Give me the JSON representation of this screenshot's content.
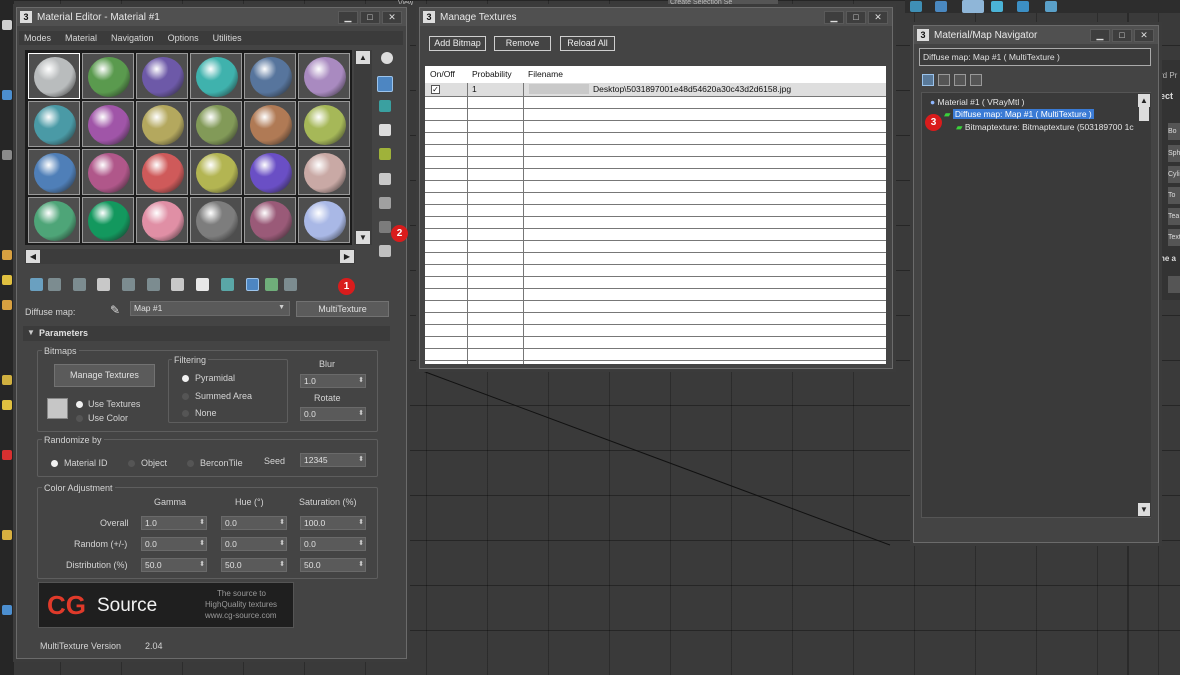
{
  "material_editor": {
    "title": "Material Editor - Material #1",
    "menu": [
      "Modes",
      "Material",
      "Navigation",
      "Options",
      "Utilities"
    ],
    "slot_colors": [
      [
        "#b9bcbd",
        "#5a9a4e",
        "#6d59a8",
        "#3fb2ad",
        "#57759d",
        "#a98ac0"
      ],
      [
        "#4a9aa6",
        "#a055a8",
        "#b4a85e",
        "#829a58",
        "#b07a55",
        "#a6b858"
      ],
      [
        "#4f7fb8",
        "#b0578a",
        "#cf5a5a",
        "#b3b552",
        "#6a4fc5",
        "#c9a9a5"
      ],
      [
        "#4ea578",
        "#13985e",
        "#e08fa5",
        "#7d7d7d",
        "#9a5a78",
        "#a9b8e6"
      ]
    ],
    "diffuse_label": "Diffuse map:",
    "map_name": "Map #1",
    "map_type_button": "MultiTexture",
    "parameters_title": "Parameters",
    "bitmaps_title": "Bitmaps",
    "manage_textures_button": "Manage Textures",
    "use_textures": "Use Textures",
    "use_color": "Use Color",
    "filtering_title": "Filtering",
    "filter_pyramidal": "Pyramidal",
    "filter_summed": "Summed Area",
    "filter_none": "None",
    "blur_label": "Blur",
    "blur_value": "1.0",
    "rotate_label": "Rotate",
    "rotate_value": "0.0",
    "randomize_title": "Randomize by",
    "rand_material": "Material ID",
    "rand_object": "Object",
    "rand_bercon": "BerconTile",
    "seed_label": "Seed",
    "seed_value": "12345",
    "color_adj_title": "Color Adjustment",
    "col_gamma": "Gamma",
    "col_hue": "Hue (°)",
    "col_saturation": "Saturation (%)",
    "row_overall": "Overall",
    "row_random": "Random (+/-)",
    "row_distribution": "Distribution (%)",
    "overall": [
      "1.0",
      "0.0",
      "100.0"
    ],
    "random": [
      "0.0",
      "0.0",
      "0.0"
    ],
    "distribution": [
      "50.0",
      "50.0",
      "50.0"
    ],
    "logo_cg": "CG",
    "logo_source": "Source",
    "logo_tagline_1": "The source to",
    "logo_tagline_2": "HighQuality textures",
    "logo_url": "www.cg-source.com",
    "version_label": "MultiTexture Version",
    "version_value": "2.04",
    "badge_1": "1",
    "badge_2": "2"
  },
  "manage_textures": {
    "title": "Manage Textures",
    "add_bitmap": "Add Bitmap",
    "remove": "Remove",
    "reload_all": "Reload All",
    "col_onoff": "On/Off",
    "col_probability": "Probability",
    "col_filename": "Filename",
    "row1_probability": "1",
    "row1_filename": "Desktop\\5031897001e48d54620a30c43d2d6158.jpg"
  },
  "navigator": {
    "title": "Material/Map Navigator",
    "header": "Diffuse map: Map #1  ( MultiTexture )",
    "tree_material": "Material #1  ( VRayMtl )",
    "tree_diffuse": "Diffuse map: Map #1  ( MultiTexture )",
    "tree_bitmap": "Bitmaptexture: Bitmaptexture (503189700 1c",
    "badge_3": "3"
  },
  "viewport": {
    "top_label": "Create Selection Se",
    "view_label": "View",
    "right_labels": [
      "rd Pr",
      "ect",
      "Bo",
      "Sph",
      "Cyli",
      "To",
      "Tea",
      "Text",
      "ne a"
    ]
  }
}
